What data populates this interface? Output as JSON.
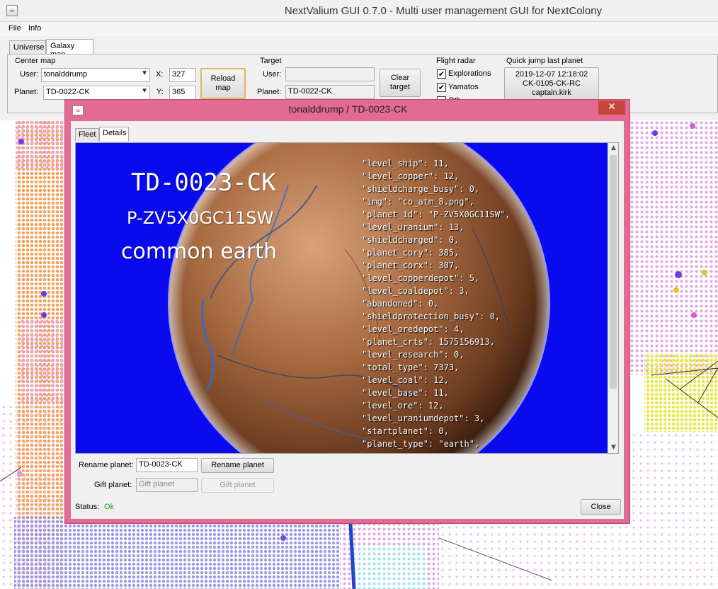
{
  "window": {
    "title": "NextValium GUI 0.7.0 - Multi user management GUI for NextColony"
  },
  "menu": [
    "File",
    "Info"
  ],
  "tabs": [
    {
      "label": "Universe",
      "active": false
    },
    {
      "label": "Galaxy map",
      "active": true
    }
  ],
  "center_map": {
    "group_label": "Center map",
    "user_label": "User:",
    "user_value": "tonalddrump",
    "planet_label": "Planet:",
    "planet_value": "TD-0022-CK",
    "x_label": "X:",
    "x_value": "327",
    "y_label": "Y:",
    "y_value": "365",
    "reload_label_1": "Reload",
    "reload_label_2": "map"
  },
  "target": {
    "group_label": "Target",
    "user_label": "User:",
    "user_value": "",
    "planet_label": "Planet:",
    "planet_value": "TD-0022-CK",
    "clear_label_1": "Clear",
    "clear_label_2": "target"
  },
  "flight_radar": {
    "group_label": "Flight radar",
    "options": [
      {
        "label": "Explorations",
        "checked": true
      },
      {
        "label": "Yamatos",
        "checked": true
      },
      {
        "label": "Oth",
        "checked": true
      }
    ]
  },
  "quick_jump": {
    "group_label": "Quick jump last planet",
    "line1": "2019-12-07 12:18:02",
    "line2": "CK-0105-CK-RC",
    "line3": "captain.kirk"
  },
  "dialog": {
    "title": "tonalddrump / TD-0023-CK",
    "close_glyph": "✕",
    "tabs": [
      {
        "label": "Fleet",
        "active": false
      },
      {
        "label": "Details",
        "active": true
      }
    ],
    "planet_name": "TD-0023-CK",
    "planet_id": "P-ZV5X0GC11SW",
    "planet_kind": "common earth",
    "json_open": "{",
    "json_lines": [
      "\"level_ship\": 11,",
      "\"level_copper\": 12,",
      "\"shieldcharge_busy\": 0,",
      "\"img\": \"co_atm_8.png\",",
      "\"planet_id\": \"P-ZV5X0GC11SW\",",
      "\"level_uranium\": 13,",
      "\"shieldcharged\": 0,",
      "\"planet_cory\": 385,",
      "\"planet_corx\": 307,",
      "\"level_copperdepot\": 5,",
      "\"level_coaldepot\": 3,",
      "\"abandoned\": 0,",
      "\"shieldprotection_busy\": 0,",
      "\"level_oredepot\": 4,",
      "\"planet_crts\": 1575156913,",
      "\"level_research\": 0,",
      "\"total_type\": 7373,",
      "\"level_coal\": 12,",
      "\"level_base\": 11,",
      "\"level_ore\": 12,",
      "\"level_uraniumdepot\": 3,",
      "\"startplanet\": 0,",
      "\"planet_type\": \"earth\","
    ],
    "rename_label": "Rename planet:",
    "rename_value": "TD-0023-CK",
    "rename_button": "Rename planet",
    "gift_label": "Gift planet:",
    "gift_placeholder": "Gift planet",
    "gift_button": "Gift planet",
    "status_label": "Status:",
    "status_value": "Ok",
    "close_button": "Close"
  },
  "colors": {
    "dialog_frame": "#e36a92",
    "scene_background": "#0a0aef",
    "status_ok": "#1aa31a",
    "map_orange": "#f4a460",
    "map_pink": "#e0a0e0",
    "map_violet": "#6a3de0",
    "map_yellow": "#e8e840"
  }
}
